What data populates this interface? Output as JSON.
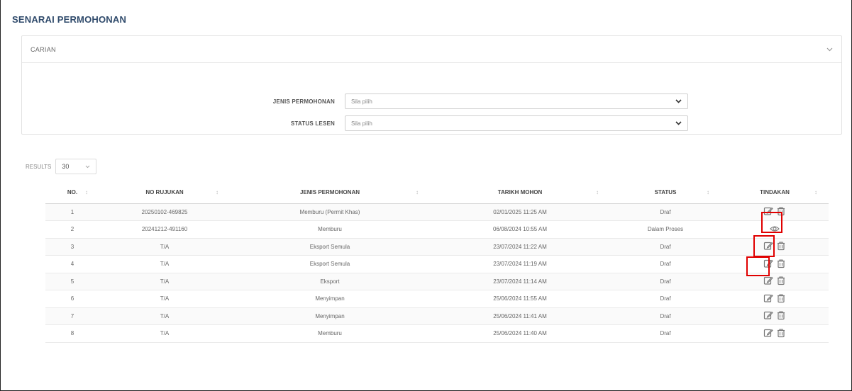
{
  "page": {
    "title": "SENARAI PERMOHONAN"
  },
  "search": {
    "header": "CARIAN",
    "fields": [
      {
        "label": "JENIS PERMOHONAN",
        "value": "Sila pilih"
      },
      {
        "label": "STATUS LESEN",
        "value": "Sila pilih"
      }
    ]
  },
  "results": {
    "label": "RESULTS",
    "value": "30"
  },
  "table": {
    "headers": [
      "NO.",
      "NO RUJUKAN",
      "JENIS PERMOHONAN",
      "TARIKH MOHON",
      "STATUS",
      "TINDAKAN"
    ],
    "rows": [
      {
        "no": "1",
        "ref": "20250102-469825",
        "type": "Memburu (Permit Khas)",
        "date": "02/01/2025 11:25 AM",
        "status": "Draf",
        "actions": [
          "edit-icon",
          "delete-icon"
        ]
      },
      {
        "no": "2",
        "ref": "20241212-491160",
        "type": "Memburu",
        "date": "06/08/2024 10:55 AM",
        "status": "Dalam Proses",
        "actions": [
          "view-icon"
        ]
      },
      {
        "no": "3",
        "ref": "T/A",
        "type": "Eksport Semula",
        "date": "23/07/2024 11:22 AM",
        "status": "Draf",
        "actions": [
          "edit-icon",
          "delete-icon"
        ]
      },
      {
        "no": "4",
        "ref": "T/A",
        "type": "Eksport Semula",
        "date": "23/07/2024 11:19 AM",
        "status": "Draf",
        "actions": [
          "edit-icon",
          "delete-icon"
        ]
      },
      {
        "no": "5",
        "ref": "T/A",
        "type": "Eksport",
        "date": "23/07/2024 11:14 AM",
        "status": "Draf",
        "actions": [
          "edit-icon",
          "delete-icon"
        ]
      },
      {
        "no": "6",
        "ref": "T/A",
        "type": "Menyimpan",
        "date": "25/06/2024 11:55 AM",
        "status": "Draf",
        "actions": [
          "edit-icon",
          "delete-icon"
        ]
      },
      {
        "no": "7",
        "ref": "T/A",
        "type": "Menyimpan",
        "date": "25/06/2024 11:41 AM",
        "status": "Draf",
        "actions": [
          "edit-icon",
          "delete-icon"
        ]
      },
      {
        "no": "8",
        "ref": "T/A",
        "type": "Memburu",
        "date": "25/06/2024 11:40 AM",
        "status": "Draf",
        "actions": [
          "edit-icon",
          "delete-icon"
        ]
      }
    ]
  },
  "colors": {
    "title": "#2f4a6b",
    "highlight": "#e00000",
    "icon": "#777777"
  }
}
